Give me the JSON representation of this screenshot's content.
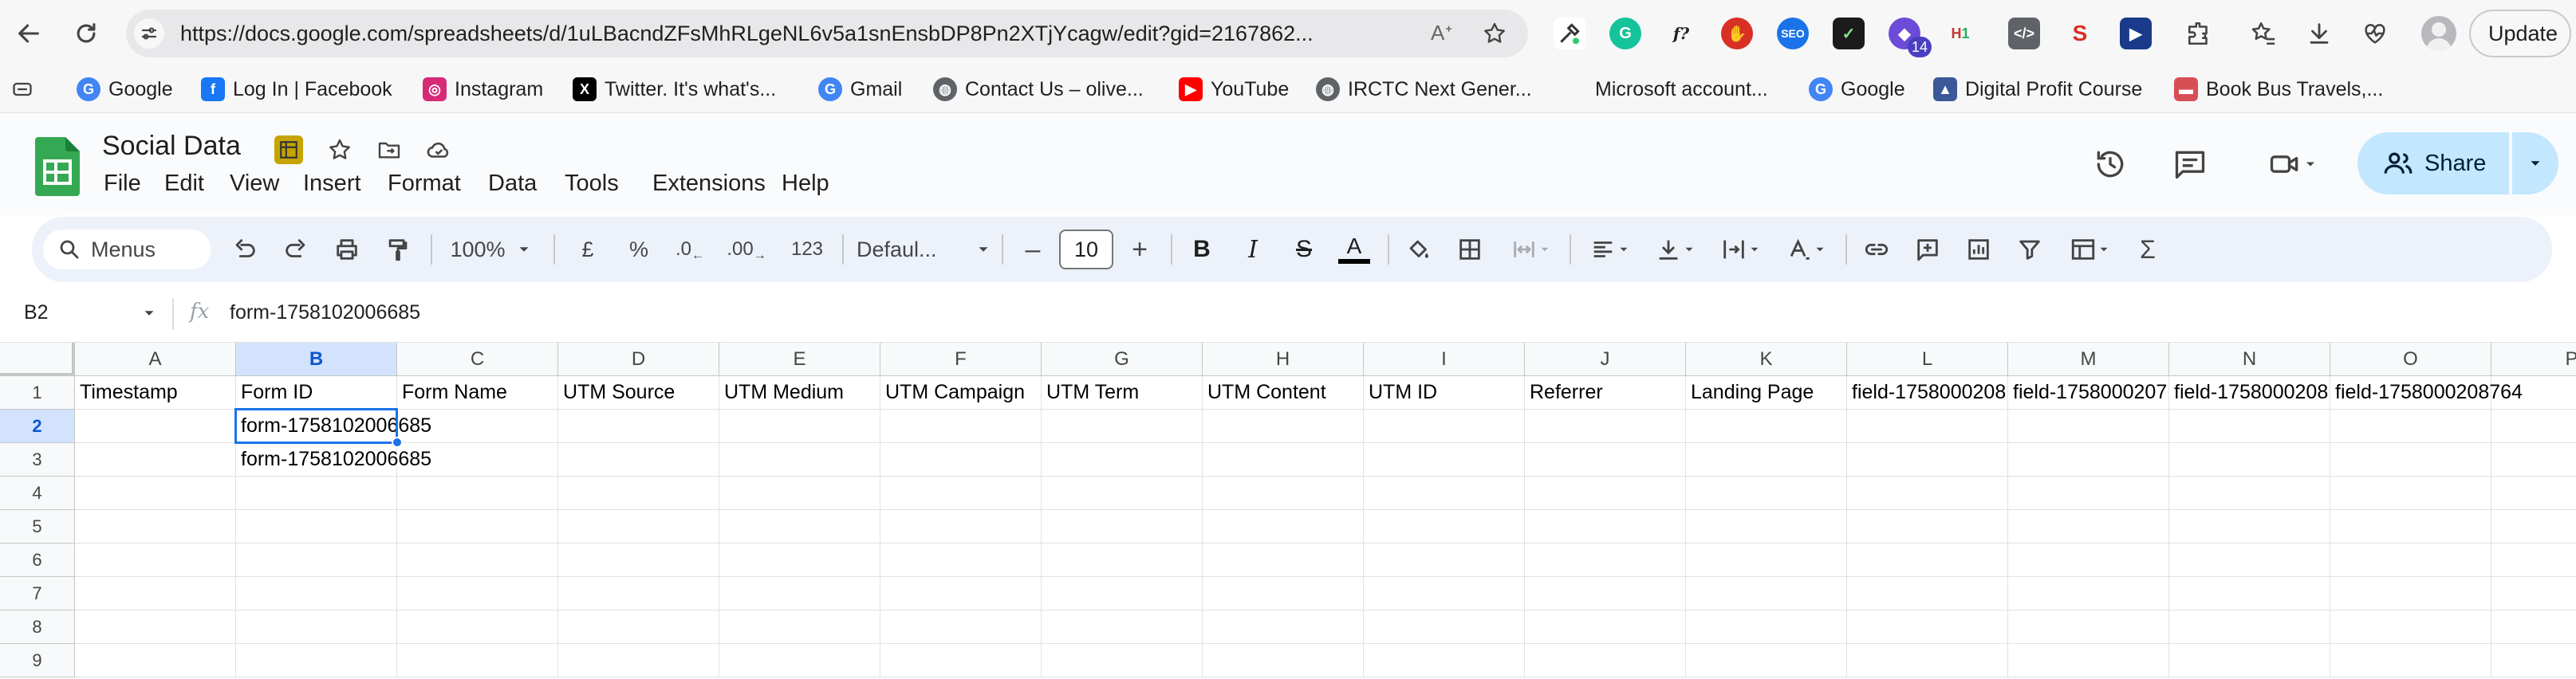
{
  "browser": {
    "url": "https://docs.google.com/spreadsheets/d/1uLBacndZFsMhRLgeNL6v5a1snEnsbDP8Pn2XTjYcagw/edit?gid=2167862...",
    "extension_badge": "14",
    "update_label": "Update"
  },
  "bookmarks": [
    {
      "label": "Google",
      "icon": "google-icon",
      "color": "#4285f4"
    },
    {
      "label": "Log In | Facebook",
      "icon": "facebook-icon",
      "color": "#1877f2"
    },
    {
      "label": "Instagram",
      "icon": "instagram-icon",
      "color": "#d62976"
    },
    {
      "label": "Twitter. It's what's...",
      "icon": "x-icon",
      "color": "#000000"
    },
    {
      "label": "Gmail",
      "icon": "google-icon",
      "color": "#4285f4"
    },
    {
      "label": "Contact Us – olive...",
      "icon": "globe-icon",
      "color": "#5f6368"
    },
    {
      "label": "YouTube",
      "icon": "youtube-icon",
      "color": "#ff0000"
    },
    {
      "label": "IRCTC Next Gener...",
      "icon": "globe-icon",
      "color": "#5f6368"
    },
    {
      "label": "Microsoft account...",
      "icon": "microsoft-icon",
      "color": "#f25022"
    },
    {
      "label": "Google",
      "icon": "google-icon",
      "color": "#4285f4"
    },
    {
      "label": "Digital Profit Course",
      "icon": "course-icon",
      "color": "#3b5998"
    },
    {
      "label": "Book Bus Travels,...",
      "icon": "bus-icon",
      "color": "#d84e55"
    }
  ],
  "doc": {
    "title": "Social Data",
    "menus": [
      "File",
      "Edit",
      "View",
      "Insert",
      "Format",
      "Data",
      "Tools",
      "Extensions",
      "Help"
    ],
    "share_label": "Share"
  },
  "toolbar": {
    "search_label": "Menus",
    "zoom": "100%",
    "currency": "£",
    "percent": "%",
    "dec_decrease": ".0",
    "dec_increase": ".00",
    "number_format": "123",
    "font": "Defaul...",
    "font_size": "10"
  },
  "formula_bar": {
    "cell_ref": "B2",
    "fx": "fx",
    "value": "form-1758102006685"
  },
  "grid": {
    "columns": [
      "A",
      "B",
      "C",
      "D",
      "E",
      "F",
      "G",
      "H",
      "I",
      "J",
      "K",
      "L",
      "M",
      "N",
      "O",
      "P"
    ],
    "rows": [
      "1",
      "2",
      "3",
      "4",
      "5",
      "6",
      "7",
      "8",
      "9"
    ],
    "headers": [
      "Timestamp",
      "Form ID",
      "Form Name",
      "UTM Source",
      "UTM Medium",
      "UTM Campaign",
      "UTM Term",
      "UTM Content",
      "UTM ID",
      "Referrer",
      "Landing Page",
      "field-1758000208",
      "field-1758000207",
      "field-1758000208",
      "field-1758000208764"
    ],
    "b2": "form-1758102006685",
    "b3": "form-1758102006685"
  }
}
